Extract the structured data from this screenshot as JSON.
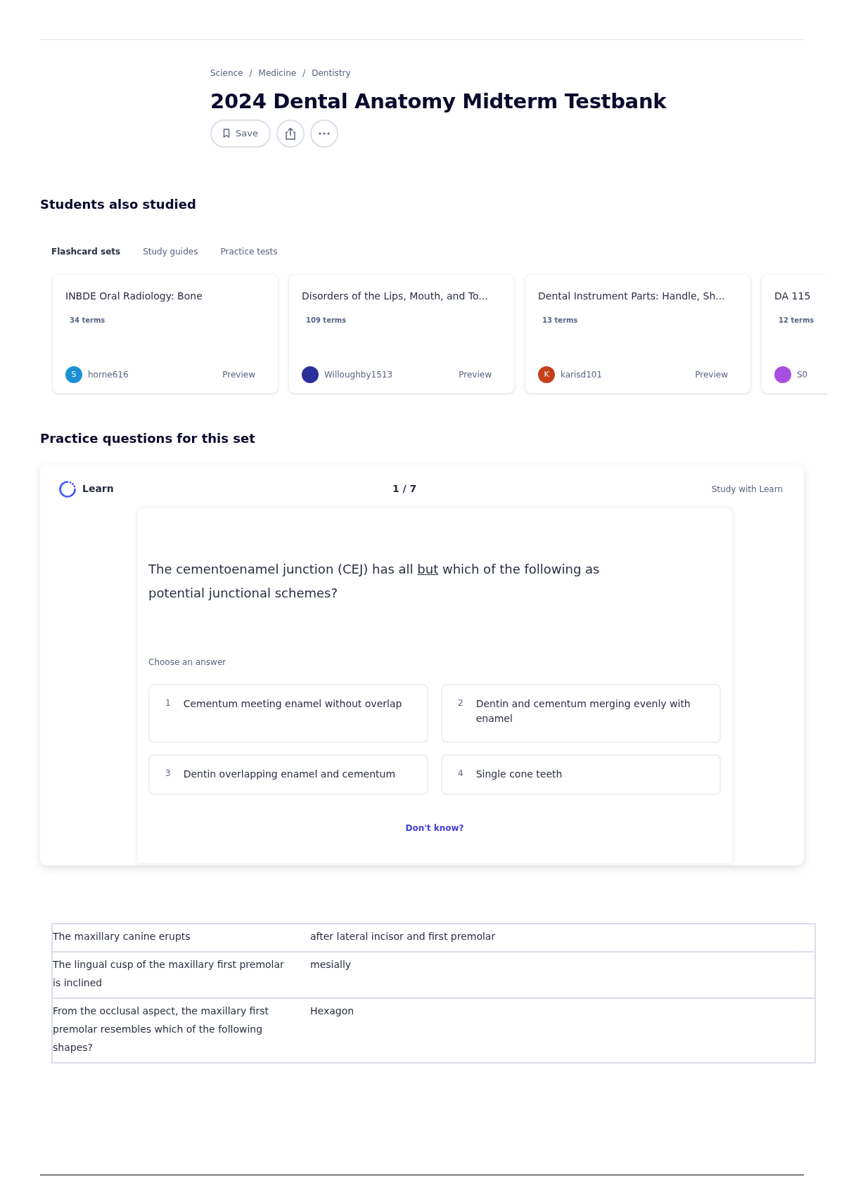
{
  "breadcrumbs": [
    {
      "label": "Science"
    },
    {
      "separator": "/",
      "label": "Medicine"
    },
    {
      "separator": "/",
      "label": "Dentistry"
    }
  ],
  "title": "2024 Dental Anatomy Midterm Testbank",
  "actions": [
    {
      "kind": "save",
      "label": "Save"
    },
    {
      "kind": "share"
    },
    {
      "kind": "more"
    }
  ],
  "students_also_studied": {
    "heading": "Students also studied",
    "tabs": [
      {
        "label": "Flashcard sets",
        "selected": true
      },
      {
        "label": "Study guides",
        "selected": false
      },
      {
        "label": "Practice tests",
        "selected": false
      }
    ],
    "cards": [
      {
        "title": "INBDE Oral Radiology: Bone",
        "terms": "34 terms",
        "user": "horne616",
        "avatar_letter": "S",
        "color": "#1a8fd6",
        "preview": "Preview"
      },
      {
        "title": "Disorders of the Lips, Mouth, and To...",
        "terms": "109 terms",
        "user": "Willoughby1513",
        "color": "#2a2f9a",
        "preview": "Preview"
      },
      {
        "title": "Dental Instrument Parts: Handle, Sh...",
        "terms": "13 terms",
        "user": "karisd101",
        "avatar_letter": "K",
        "color": "#c63f1c",
        "preview": "Preview"
      },
      {
        "title": "DA 115",
        "terms": "12 terms",
        "user": "S0",
        "color": "#a84ee0"
      }
    ]
  },
  "practice": {
    "heading": "Practice questions for this set",
    "mode": "Learn",
    "progress": "1 / 7",
    "study_link": "Study with Learn",
    "question_parts": [
      {
        "text": "The cementoenamel junction (CEJ) has all ",
        "underline": false
      },
      {
        "text": "but",
        "underline": true
      },
      {
        "text": " which of the following as potential junctional schemes?",
        "underline": false
      }
    ],
    "prompt": "Choose an answer",
    "answers": [
      {
        "number": "1",
        "text": "Cementum meeting enamel without overlap"
      },
      {
        "number": "2",
        "text": "Dentin and cementum merging evenly with enamel"
      },
      {
        "number": "3",
        "text": "Dentin overlapping enamel and cementum"
      },
      {
        "number": "4",
        "text": "Single cone teeth"
      }
    ],
    "dont_know": "Don't know?"
  },
  "terms_table": [
    [
      "The maxillary canine erupts",
      "after lateral incisor and first premolar"
    ],
    [
      "The lingual cusp of the maxillary first premolar is inclined",
      "mesially"
    ],
    [
      "From the occlusal aspect, the maxillary first premolar resembles which of the following shapes?",
      "Hexagon"
    ]
  ]
}
